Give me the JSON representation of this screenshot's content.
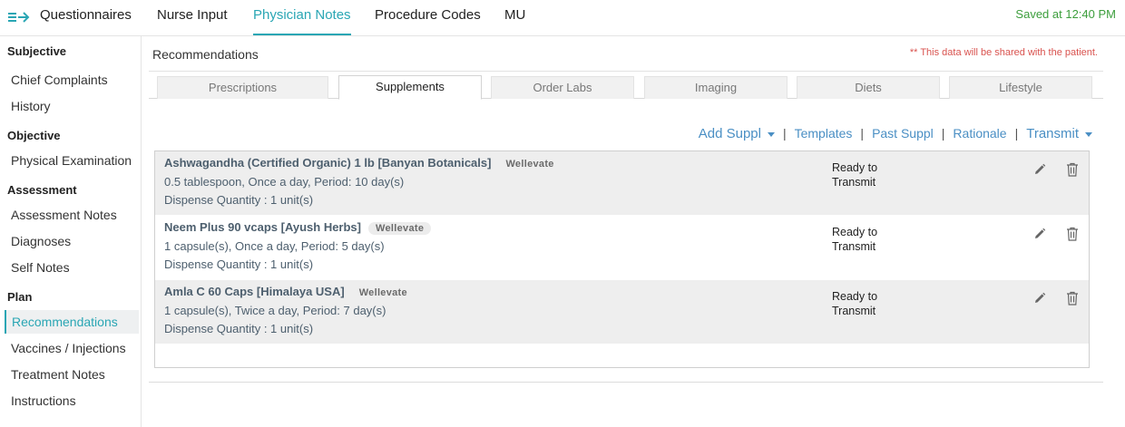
{
  "topnav": {
    "tabs": [
      "Questionnaires",
      "Nurse Input",
      "Physician Notes",
      "Procedure Codes",
      "MU"
    ],
    "saved_status": "Saved at 12:40 PM"
  },
  "sidebar": {
    "sections": [
      {
        "heading": "Subjective",
        "items": [
          "Chief Complaints",
          "History"
        ]
      },
      {
        "heading": "Objective",
        "items": [
          "Physical Examination"
        ]
      },
      {
        "heading": "Assessment",
        "items": [
          "Assessment Notes",
          "Diagnoses",
          "Self Notes"
        ]
      },
      {
        "heading": "Plan",
        "items": [
          "Recommendations",
          "Vaccines / Injections",
          "Treatment Notes",
          "Instructions"
        ]
      }
    ],
    "active_item": "Recommendations"
  },
  "main": {
    "title": "Recommendations",
    "notice": "** This data will be shared with the patient.",
    "subtabs": [
      "Prescriptions",
      "Supplements",
      "Order Labs",
      "Imaging",
      "Diets",
      "Lifestyle"
    ],
    "active_subtab": "Supplements",
    "actions": {
      "add": "Add Suppl",
      "templates": "Templates",
      "past": "Past Suppl",
      "rationale": "Rationale",
      "transmit": "Transmit"
    },
    "items": [
      {
        "name": "Ashwagandha (Certified Organic) 1 lb  [Banyan Botanicals]",
        "source": "Wellevate",
        "dose": "0.5  tablespoon,  Once a day, Period:  10 day(s)",
        "quantity": "Dispense Quantity :  1 unit(s)",
        "status_line1": "Ready to",
        "status_line2": "Transmit"
      },
      {
        "name": "Neem Plus 90 vcaps  [Ayush Herbs]",
        "source": "Wellevate",
        "dose": "1  capsule(s),  Once a day, Period:  5 day(s)",
        "quantity": "Dispense Quantity :  1 unit(s)",
        "status_line1": "Ready to",
        "status_line2": "Transmit"
      },
      {
        "name": "Amla C 60 Caps  [Himalaya USA]",
        "source": "Wellevate",
        "dose": "1  capsule(s),  Twice a day, Period:  7 day(s)",
        "quantity": "Dispense Quantity :  1 unit(s)",
        "status_line1": "Ready to",
        "status_line2": "Transmit"
      }
    ]
  },
  "colors": {
    "accent": "#2aa6b4",
    "link": "#4a8fc4",
    "saved": "#3c9e3c",
    "notice": "#d9534f"
  },
  "icons": [
    "menu-toggle-icon",
    "edit-pencil-icon",
    "trash-icon",
    "caret-down-icon"
  ]
}
